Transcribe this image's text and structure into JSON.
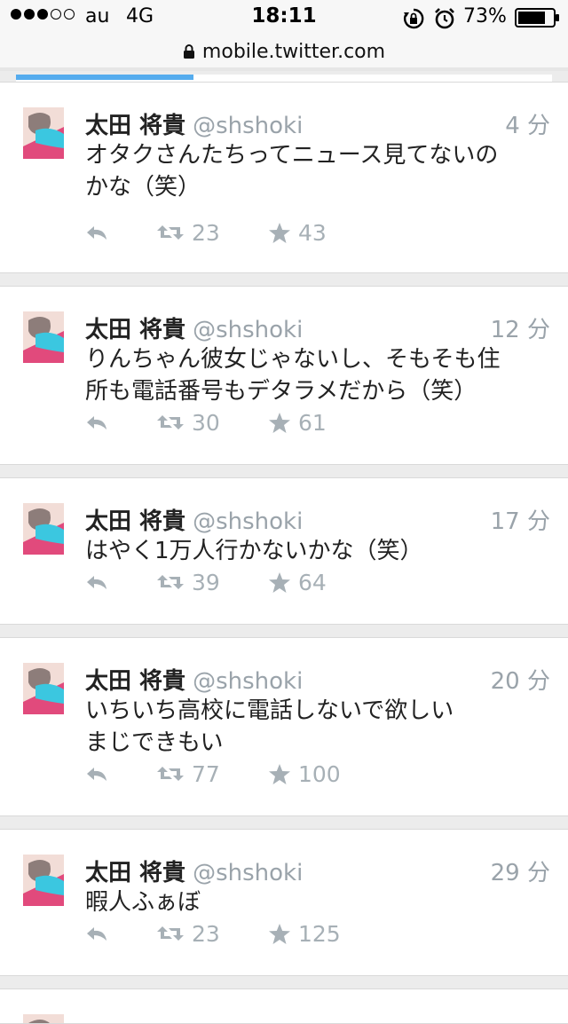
{
  "status_bar": {
    "carrier": "au",
    "network": "4G",
    "time": "18:11",
    "battery": "73%"
  },
  "browser": {
    "url": "mobile.twitter.com"
  },
  "colors": {
    "accent": "#55acee",
    "muted": "#9aa3aa"
  },
  "tweets": [
    {
      "name": "太田 将貴",
      "handle": "@shshoki",
      "time": "4 分",
      "text_line1": "オタクさんたちってニュース見てないの",
      "text_line2": "かな（笑）",
      "retweets": "23",
      "favorites": "43"
    },
    {
      "name": "太田 将貴",
      "handle": "@shshoki",
      "time": "12 分",
      "text_line1": "りんちゃん彼女じゃないし、そもそも住",
      "text_line2": "所も電話番号もデタラメだから（笑）",
      "retweets": "30",
      "favorites": "61"
    },
    {
      "name": "太田 将貴",
      "handle": "@shshoki",
      "time": "17 分",
      "text_line1": "はやく1万人行かないかな（笑）",
      "text_line2": "",
      "retweets": "39",
      "favorites": "64"
    },
    {
      "name": "太田 将貴",
      "handle": "@shshoki",
      "time": "20 分",
      "text_line1": "いちいち高校に電話しないで欲しい",
      "text_line2": "まじできもい",
      "retweets": "77",
      "favorites": "100"
    },
    {
      "name": "太田 将貴",
      "handle": "@shshoki",
      "time": "29 分",
      "text_line1": "暇人ふぁぼ",
      "text_line2": "",
      "retweets": "23",
      "favorites": "125"
    }
  ],
  "icons": {
    "reply": "reply-icon",
    "retweet": "retweet-icon",
    "favorite": "star-icon",
    "lock": "lock-icon",
    "alarm": "alarm-icon",
    "orientation_lock": "orientation-lock-icon",
    "battery": "battery-icon"
  }
}
